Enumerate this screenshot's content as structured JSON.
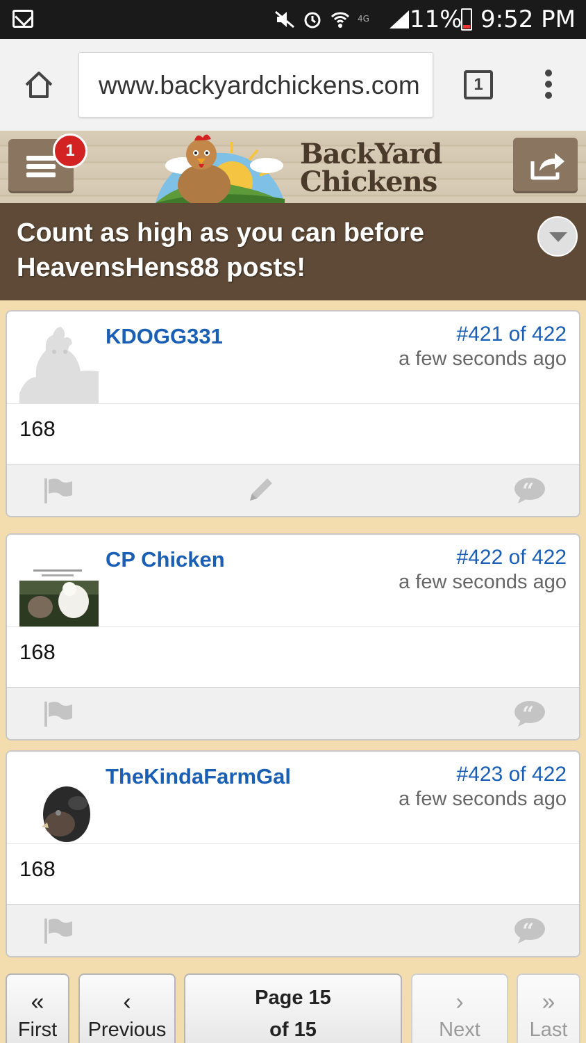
{
  "status_bar": {
    "battery": "11%",
    "time": "9:52 PM",
    "icons": [
      "mail-icon",
      "mute-icon",
      "alarm-icon",
      "wifi-icon",
      "lte-icon",
      "signal-icon",
      "battery-icon"
    ]
  },
  "browser": {
    "url": "www.backyardchickens.com",
    "tab_count": "1",
    "icons": [
      "home-icon",
      "tabs-icon",
      "more-menu-icon"
    ]
  },
  "site_header": {
    "notification_count": "1",
    "logo_line1": "BackYard",
    "logo_line2": "Chickens",
    "icons": [
      "hamburger-icon",
      "share-icon"
    ]
  },
  "thread": {
    "title": "Count as high as you can before HeavensHens88 posts!"
  },
  "posts": [
    {
      "username": "KDOGG331",
      "post_number": "#421 of 422",
      "time": "a few seconds ago",
      "body": "168",
      "actions": [
        "flag-icon",
        "edit-icon",
        "quote-icon"
      ]
    },
    {
      "username": "CP Chicken",
      "post_number": "#422 of 422",
      "time": "a few seconds ago",
      "body": "168",
      "actions": [
        "flag-icon",
        "quote-icon"
      ]
    },
    {
      "username": "TheKindaFarmGal",
      "post_number": "#423 of 422",
      "time": "a few seconds ago",
      "body": "168",
      "actions": [
        "flag-icon",
        "quote-icon"
      ]
    }
  ],
  "pagination": {
    "first_arrow": "«",
    "first_label": "First",
    "prev_arrow": "‹",
    "prev_label": "Previous",
    "page_line1": "Page 15",
    "page_line2": "of 15",
    "next_arrow": "›",
    "next_label": "Next",
    "last_arrow": "»",
    "last_label": "Last"
  }
}
